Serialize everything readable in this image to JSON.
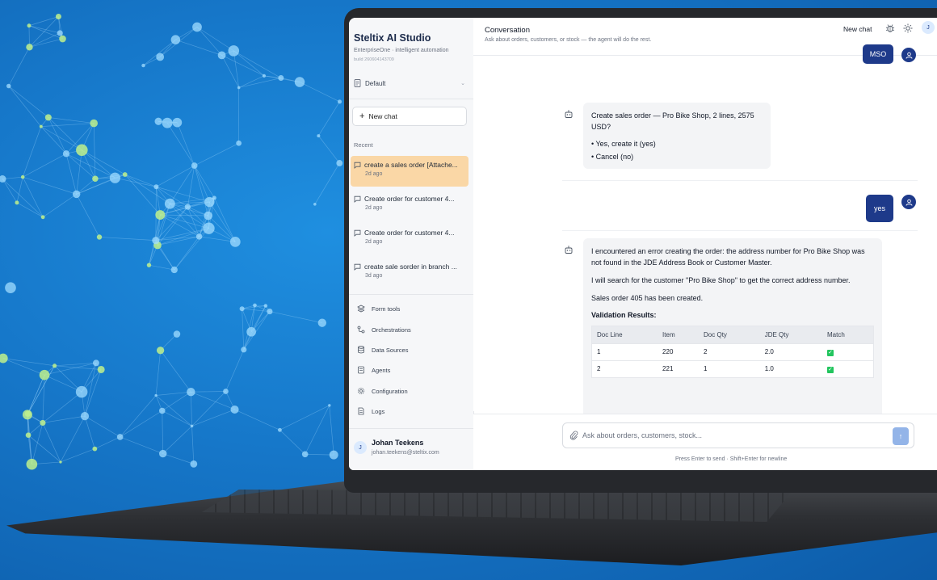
{
  "sidebar": {
    "brand_title": "Steltix AI Studio",
    "brand_subtitle": "EnterpriseOne · intelligent automation",
    "build": "build 260604143709",
    "profile": "Default",
    "new_chat_label": "New chat",
    "recent_label": "Recent",
    "recent_items": [
      {
        "title": "create a sales order [Attache...",
        "date": "2d ago",
        "active": true
      },
      {
        "title": "Create order for customer 4...",
        "date": "2d ago"
      },
      {
        "title": "Create order for customer 4...",
        "date": "2d ago"
      },
      {
        "title": "create sale sorder in branch ...",
        "date": "3d ago"
      }
    ],
    "nav_items": [
      {
        "label": "Form tools",
        "icon": "layers-icon"
      },
      {
        "label": "Orchestrations",
        "icon": "flow-icon"
      },
      {
        "label": "Data Sources",
        "icon": "database-icon"
      },
      {
        "label": "Agents",
        "icon": "agent-icon"
      },
      {
        "label": "Configuration",
        "icon": "gear-icon"
      },
      {
        "label": "Logs",
        "icon": "logs-icon"
      }
    ],
    "user": {
      "initial": "J",
      "name": "Johan Teekens",
      "email": "johan.teekens@steltix.com"
    }
  },
  "header": {
    "title": "Conversation",
    "subtitle": "Ask about orders, customers, or stock — the agent will do the rest.",
    "new_chat_label": "New chat",
    "avatar_initial": "J"
  },
  "messages": {
    "top_user_bubble": "MSO",
    "confirm": {
      "question": "Create sales order — Pro Bike Shop, 2 lines, 2575 USD?",
      "options": [
        "Yes, create it (yes)",
        "Cancel (no)"
      ]
    },
    "user_reply": "yes",
    "result": {
      "paragraphs": [
        "I encountered an error creating the order: the address number for Pro Bike Shop was not found in the JDE Address Book or Customer Master.",
        "I will search for the customer \"Pro Bike Shop\" to get the correct address number.",
        "Sales order 405 has been created."
      ],
      "validation_title": "Validation Results:",
      "table": {
        "headers": [
          "Doc Line",
          "Item",
          "Doc Qty",
          "JDE Qty",
          "Match"
        ],
        "rows": [
          [
            "1",
            "220",
            "2",
            "2.0",
            "✓"
          ],
          [
            "2",
            "221",
            "1",
            "1.0",
            "✓"
          ]
        ]
      }
    }
  },
  "composer": {
    "placeholder": "Ask about orders, customers, stock...",
    "hint": "Press Enter to send · Shift+Enter for newline"
  },
  "colors": {
    "primary": "#1e3a8a",
    "active_recent": "#fad7a6",
    "background_blue": "#1677c9",
    "match_green": "#22c55e"
  }
}
